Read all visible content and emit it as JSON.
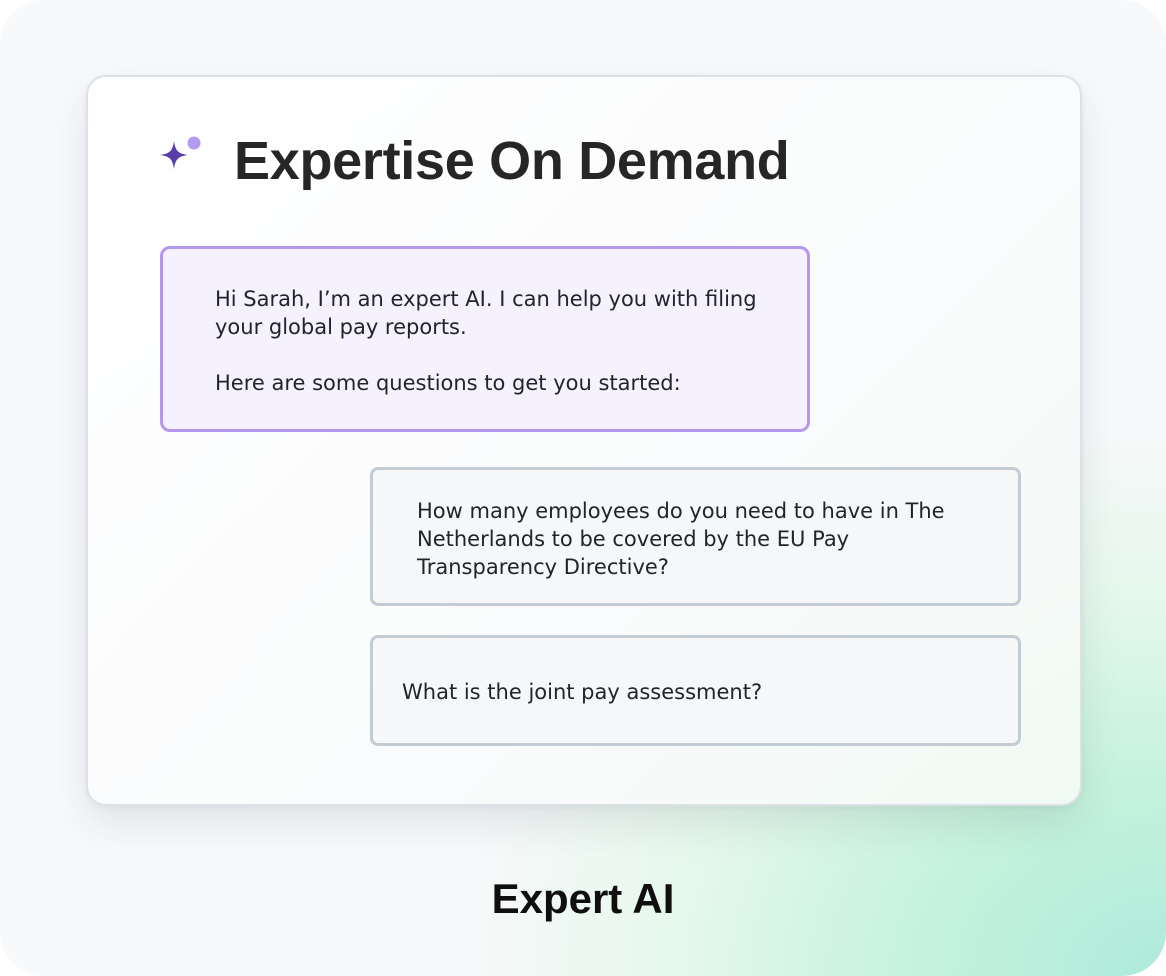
{
  "card": {
    "title": "Expertise On Demand",
    "icon": "sparkle-icon"
  },
  "chat": {
    "ai_message": {
      "line1": "Hi Sarah, I’m an expert AI. I can help you with filing your global pay reports.",
      "line2": "Here are some questions to get you started:"
    },
    "suggestions": [
      {
        "text": "How many employees do you need to have in The Netherlands to be covered by the EU Pay Transparency Directive?"
      },
      {
        "text": "What is the joint pay assessment?"
      }
    ]
  },
  "caption": "Expert AI",
  "colors": {
    "accent_purple": "#5a3ea8",
    "accent_light_purple": "#b39cf0",
    "ai_bubble_border": "#b498ec",
    "ai_bubble_bg": "#f5f1fe",
    "suggestion_border": "#c3ccd5",
    "suggestion_bg": "#f5f7f9"
  }
}
